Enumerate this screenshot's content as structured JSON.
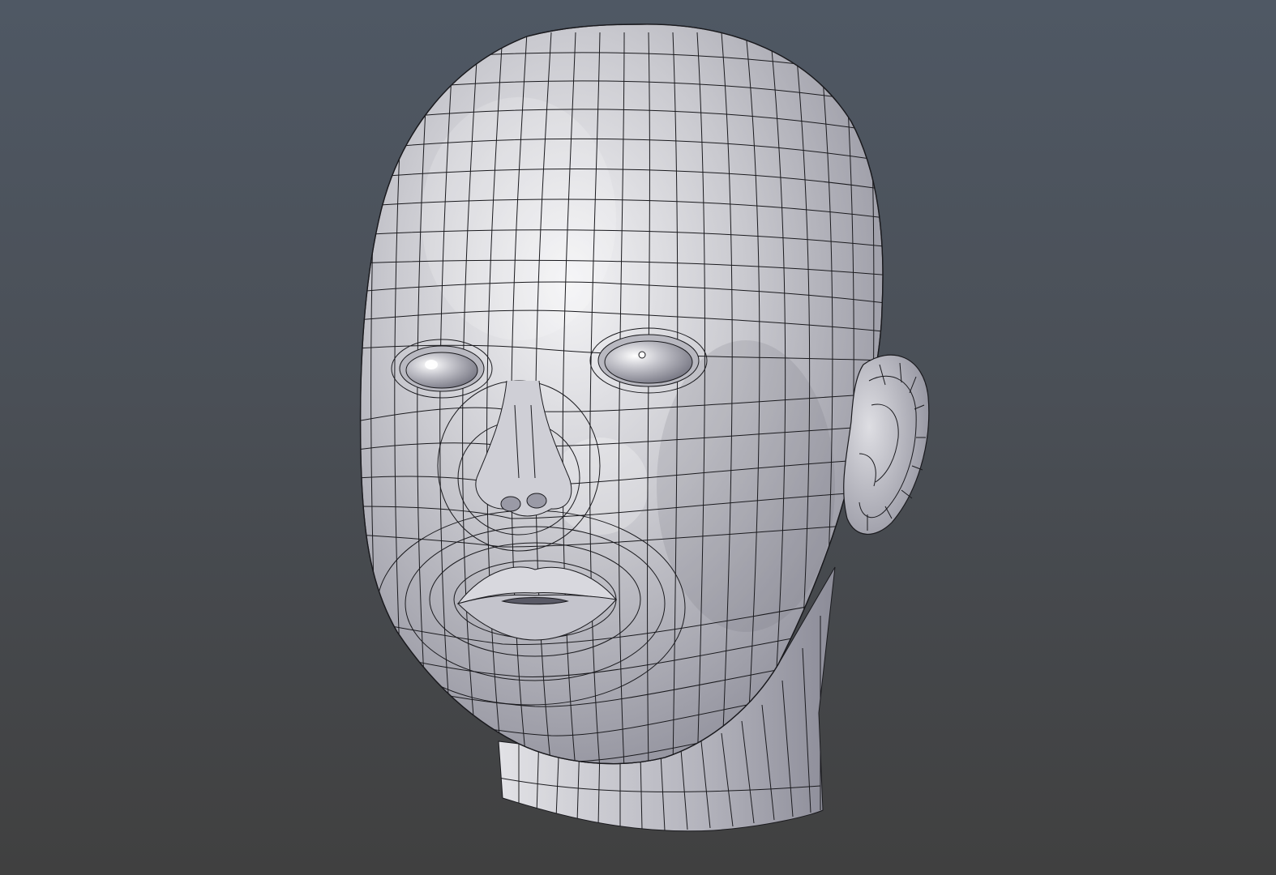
{
  "viewport": {
    "background_top": "#4f5864",
    "background_bottom": "#404040",
    "object": "head-mesh",
    "shading": "solid",
    "wireframe_overlay": true
  },
  "mesh": {
    "surface_highlight": "#f4f4f6",
    "surface_base": "#c9c9cf",
    "surface_shadow": "#8a8a96",
    "wire_color": "#1a1a1e"
  }
}
